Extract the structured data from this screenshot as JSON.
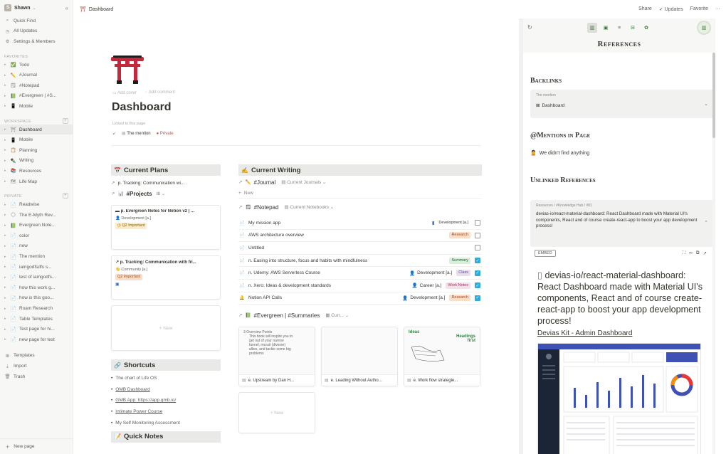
{
  "sidebar": {
    "workspace": "Shawn",
    "workspace_initial": "S",
    "top": [
      {
        "icon": "search-icon",
        "label": "Quick Find"
      },
      {
        "icon": "clock-icon",
        "label": "All Updates"
      },
      {
        "icon": "gear-icon",
        "label": "Settings & Members"
      }
    ],
    "favorites_label": "FAVORITES",
    "favorites": [
      {
        "icon": "✅",
        "label": "Todo"
      },
      {
        "icon": "✏️",
        "label": "#Journal"
      },
      {
        "icon": "🗒",
        "label": "#Notepad"
      },
      {
        "icon": "📗",
        "label": "#Evergreen | #S..."
      },
      {
        "icon": "📱",
        "label": "Mobile"
      }
    ],
    "workspace_label": "WORKSPACE",
    "workspace_items": [
      {
        "icon": "⛩",
        "label": "Dashboard",
        "active": true
      },
      {
        "icon": "📱",
        "label": "Mobile"
      },
      {
        "icon": "📋",
        "label": "Planning"
      },
      {
        "icon": "✒️",
        "label": "Writing"
      },
      {
        "icon": "📚",
        "label": "Resources"
      },
      {
        "icon": "🗺",
        "label": "Life Map"
      }
    ],
    "private_label": "PRIVATE",
    "private_items": [
      {
        "icon": "📄",
        "label": "Readwise"
      },
      {
        "icon": "🌕",
        "label": "The E-Myth Rev..."
      },
      {
        "icon": "📗",
        "label": "Evergreen Note..."
      },
      {
        "icon": "📄",
        "label": "color"
      },
      {
        "icon": "📄",
        "label": "new"
      },
      {
        "icon": "📄",
        "label": "The mention"
      },
      {
        "icon": "📄",
        "label": "iamgodfsdfs s..."
      },
      {
        "icon": "📄",
        "label": "test of iamgodfs..."
      },
      {
        "icon": "📄",
        "label": "how this work g..."
      },
      {
        "icon": "📄",
        "label": "how is this goo..."
      },
      {
        "icon": "📄",
        "label": "Roam Research"
      },
      {
        "icon": "📄",
        "label": "Table Templates"
      },
      {
        "icon": "📄",
        "label": "Test page for hi..."
      },
      {
        "icon": "📄",
        "label": "new page for test"
      }
    ],
    "bottom": [
      {
        "icon": "templates-icon",
        "label": "Templates"
      },
      {
        "icon": "import-icon",
        "label": "Import"
      },
      {
        "icon": "trash-icon",
        "label": "Trash"
      }
    ],
    "new_page": "New page"
  },
  "topbar": {
    "crumb_icon": "⛩",
    "crumb": "Dashboard",
    "share": "Share",
    "updates": "Updates",
    "favorite": "Favorite"
  },
  "page": {
    "add_cover": "Add cover",
    "add_comment": "Add comment",
    "title": "Dashboard",
    "linked_to": "Linked to this page",
    "mention": "The mention",
    "private": "Private"
  },
  "plans": {
    "heading": "Current Plans",
    "tracking": "p. Tracking: Communication wi...",
    "projects": "#Projects",
    "card1": {
      "title": "p. Evergreen Notes for Notion v2 | ...",
      "tag1": "Development [a.]",
      "tag2": "Q2 Important"
    },
    "card2": {
      "title": "p. Tracking: Communication with fri...",
      "tag1": "Community [a.]",
      "tag2": "Q2 Important"
    },
    "new": "+ New"
  },
  "shortcuts": {
    "heading": "Shortcuts",
    "items": [
      "The chart of Life OS",
      "OMB Dashboard",
      "GMB App: https://app.gmb.io/",
      "Intimate Power Course",
      "My Self Monitoring Assessment"
    ]
  },
  "quick_heading": "Quick Notes",
  "writing": {
    "heading": "Current Writing",
    "journal": "#Journal",
    "journal_view": "Current Journals",
    "new": "New",
    "notepad": "#Notepad",
    "notepad_view": "Current Notebooks",
    "rows": [
      {
        "name": "My mission app",
        "person": "",
        "tag": "Development [a.]",
        "tagc": "none",
        "checked": false,
        "icon": "📄"
      },
      {
        "name": "AWS architecture overview",
        "person": "",
        "tag": "Research",
        "tagc": "or",
        "checked": false,
        "icon": "📄"
      },
      {
        "name": "Untitled",
        "person": "",
        "tag": "",
        "tagc": "none",
        "checked": false,
        "icon": "📄"
      },
      {
        "name": "n. Easing into structure, focus and habits with mindfulness",
        "person": "",
        "tag": "Summary",
        "tagc": "gr",
        "checked": true,
        "icon": "📄"
      },
      {
        "name": "n. Udemy: AWS Serverless Course",
        "person": "Development [a.]",
        "tag": "Class",
        "tagc": "pu",
        "checked": true,
        "icon": "📄"
      },
      {
        "name": "n. Xero: Ideas & development standards",
        "person": "Career [a.]",
        "tag": "Work Notes",
        "tagc": "pk",
        "checked": true,
        "icon": "📄"
      },
      {
        "name": "Notion API Calls",
        "person": "Development [a.]",
        "tag": "Research",
        "tagc": "or",
        "checked": true,
        "icon": "🔔"
      }
    ],
    "evergreen": "#Evergreen | #Summaries",
    "evergreen_view": "Curr...",
    "gallery": [
      {
        "caption": "e. Upstream by Dan H...",
        "preview_title": "3 Overview Points",
        "preview_lines": [
          "This book will inspire you to",
          "get out of your narrow",
          "tunnel, recruit (diverse)",
          "allies, and tackle some big",
          "problems"
        ]
      },
      {
        "caption": "e. Leading Without Autho...",
        "preview_title": "",
        "preview_lines": []
      },
      {
        "caption": "e. Work flow strategie...",
        "preview_title": "Ideas",
        "preview_lines": [
          "Headings",
          "first"
        ]
      }
    ],
    "new2": "+ New"
  },
  "refs": {
    "title": "References",
    "backlinks": "Backlinks",
    "bl_small": "The mention",
    "bl_item": "Dashboard",
    "mentions": "@Mentions in Page",
    "mentions_empty": "We didn't find anything",
    "unlinked": "Unlinked References",
    "un_small": "Resources  /  #Knowledge Hub  /  #81",
    "un_text": "devias-io/react-material-dashboard: React Dashboard made with Material UI's components, React and of course create-react-app to boost your app development process!",
    "embed": "EMBED",
    "big_title": "devias-io/react-material-dashboard: React Dashboard made with Material UI's components, React and of course create-react-app to boost your app development process!",
    "big_link": "Devias Kit - Admin Dashboard"
  },
  "colors": {
    "accent": "#2eaadc",
    "danger": "#d44c47",
    "green": "#3c7a3c"
  }
}
